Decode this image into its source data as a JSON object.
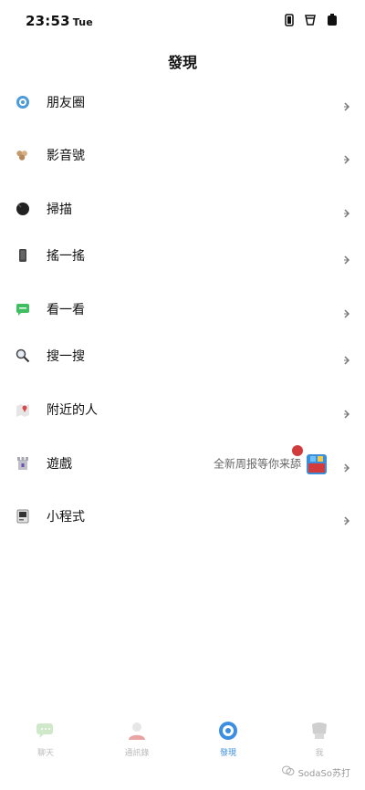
{
  "status_bar": {
    "time": "23:53",
    "day": "Tue"
  },
  "header": {
    "title": "發現"
  },
  "menu": [
    {
      "label": "朋友圈",
      "icon": "moments-icon"
    },
    {
      "label": "影音號",
      "icon": "channels-icon"
    },
    {
      "label": "掃描",
      "icon": "scan-icon"
    },
    {
      "label": "搖一搖",
      "icon": "shake-icon"
    },
    {
      "label": "看一看",
      "icon": "top-stories-icon"
    },
    {
      "label": "搜一搜",
      "icon": "search-icon"
    },
    {
      "label": "附近的人",
      "icon": "people-nearby-icon"
    },
    {
      "label": "遊戲",
      "icon": "games-icon",
      "extra": "全新周报等你来舔"
    },
    {
      "label": "小程式",
      "icon": "mini-programs-icon"
    }
  ],
  "tabbar": {
    "tabs": [
      {
        "label": "聊天",
        "icon": "chats-icon",
        "active": false
      },
      {
        "label": "通訊錄",
        "icon": "contacts-icon",
        "active": false
      },
      {
        "label": "發現",
        "icon": "discover-icon",
        "active": true
      },
      {
        "label": "我",
        "icon": "me-icon",
        "active": false
      }
    ]
  },
  "watermark": {
    "text": "SodaSo苏打"
  },
  "colors": {
    "accent": "#3b8ee0",
    "badge": "#d23b3b"
  }
}
